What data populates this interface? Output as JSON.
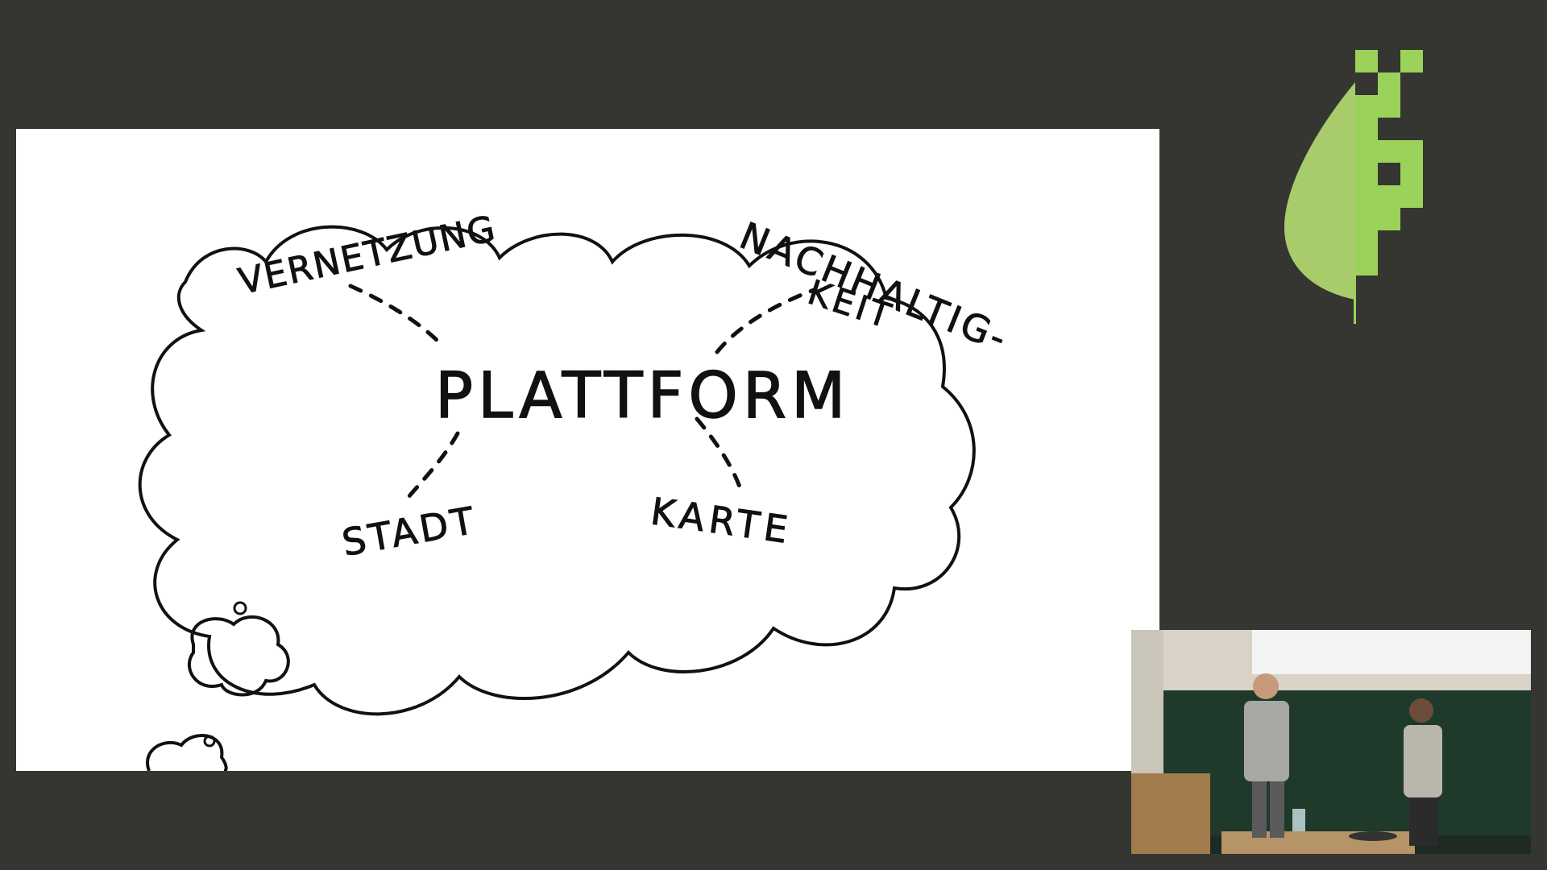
{
  "slide": {
    "center_word": "PLATTFORM",
    "concepts": {
      "top_left": "VERNETZUNG",
      "top_right_line1": "NACHHALTIG-",
      "top_right_line2": "KEIT",
      "bottom_left": "STADT",
      "bottom_right": "KARTE"
    }
  },
  "logo": {
    "icon": "leaf-pixel-logo",
    "colors": {
      "light": "#a8cc6c",
      "bright": "#9bd25a"
    }
  },
  "camera_feed": {
    "description_icon": "speaker-video-feed"
  }
}
